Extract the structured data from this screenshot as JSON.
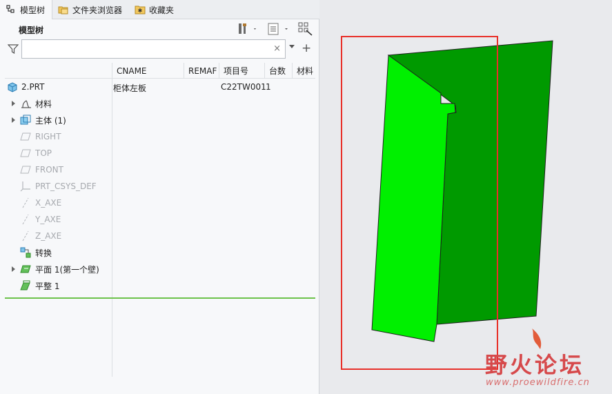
{
  "tabs": [
    {
      "label": "模型树",
      "icon": "model-tree-icon"
    },
    {
      "label": "文件夹浏览器",
      "icon": "folder-browser-icon"
    },
    {
      "label": "收藏夹",
      "icon": "favorites-icon"
    }
  ],
  "panel": {
    "title": "模型树",
    "settings_icon": "tree-settings-icon",
    "show_icon": "tree-show-icon",
    "filter_icon": "tree-filter-icon"
  },
  "search": {
    "value": "",
    "placeholder": "",
    "clear_label": "×",
    "add_label": "+"
  },
  "columns": [
    "CNAME",
    "REMAF",
    "项目号",
    "台数",
    "材料"
  ],
  "tree": [
    {
      "label": "2.PRT",
      "icon": "part-icon",
      "cname": "柜体左板",
      "project": "C22TW001",
      "count": "1"
    },
    {
      "label": "材料",
      "icon": "material-icon",
      "expandable": true
    },
    {
      "label": "主体 (1)",
      "icon": "body-icon",
      "expandable": true
    },
    {
      "label": "RIGHT",
      "icon": "datum-plane-icon",
      "dim": true
    },
    {
      "label": "TOP",
      "icon": "datum-plane-icon",
      "dim": true
    },
    {
      "label": "FRONT",
      "icon": "datum-plane-icon",
      "dim": true
    },
    {
      "label": "PRT_CSYS_DEF",
      "icon": "csys-icon",
      "dim": true
    },
    {
      "label": "X_AXE",
      "icon": "datum-axis-icon",
      "dim": true
    },
    {
      "label": "Y_AXE",
      "icon": "datum-axis-icon",
      "dim": true
    },
    {
      "label": "Z_AXE",
      "icon": "datum-axis-icon",
      "dim": true
    },
    {
      "label": "转换",
      "icon": "convert-icon"
    },
    {
      "label": "平面 1(第一个壁)",
      "icon": "planar-wall-icon",
      "expandable": true
    },
    {
      "label": "平整 1",
      "icon": "flat-wall-icon"
    }
  ],
  "graphics": {
    "model_colors": {
      "front": "#00f000",
      "back": "#009a00",
      "edge": "#1e1e1e"
    },
    "highlight_color": "#e8302a",
    "watermark": "野火论坛",
    "watermark_url": "www.proewildfire.cn"
  }
}
